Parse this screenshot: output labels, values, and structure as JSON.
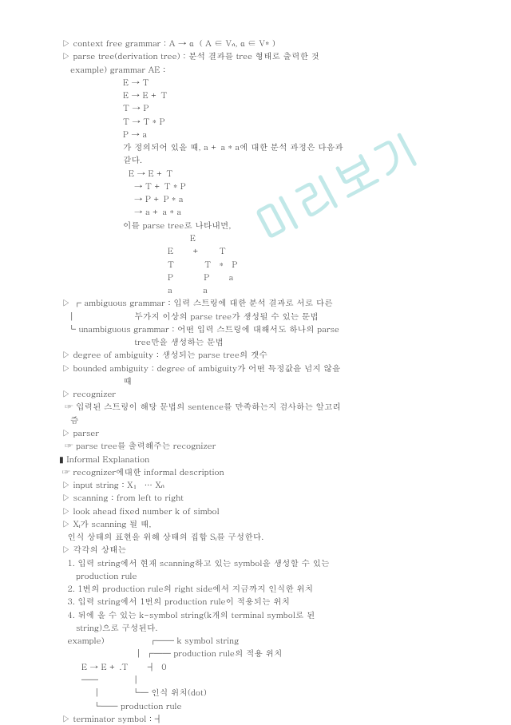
{
  "watermark": "미리보기",
  "lines": [
    " ▷ context free grammar : A → α  ( A ∈ Vₙ, α ∈ V* )",
    " ▷ parse tree(derivation tree) : 분석 결과를 tree 형태로 출력한 것",
    "example) grammar AE :",
    "E → T",
    "E → E + T",
    "T → P",
    "T → T * P",
    "P → a",
    "가 정의되어 있을 때, a + a * a에 대한 분석 과정은 다음과",
    "같다.",
    "  E → E + T",
    "    → T + T * P",
    "    → P + P * a",
    "    → a + a * a",
    "이를 parse tree로 나타내면,",
    "                        E",
    "                E       +       T",
    "                T           T   *   P",
    "                P           P       a",
    "                a           a",
    " ▷ ┌ ambiguous grammar : 입력 스트링에 대한 분석 결과로 서로 다른",
    "   │                     두가지 이상의 parse tree가 생성될 수 있는 문법",
    "   └ unambiguous grammar : 어떤 입력 스트링에 대해서도 하나의 parse",
    "                           tree만을 생성하는 문법",
    " ▷ degree of ambiguity : 생성되는 parse tree의 갯수",
    " ▷ bounded ambiguity : degree of ambiguity가 어떤 특정값을 넘지 않을",
    "                       때",
    " ▷ recognizer",
    "  ☞ 입력된 스트링이 해당 문법의 sentence를 만족하는지 검사하는 알고리",
    "    즘",
    " ▷ parser",
    "  ☞ parse tree를 출력해주는 recognizer",
    "▮ Informal Explanation",
    " ☞ recognizer에대한 informal description",
    " ▷ input string : X₁ … Xₙ",
    " ▷ scanning : from left to right",
    " ▷ look ahead fixed number k of simbol",
    " ▷ Xᵢ가 scanning 될 때,",
    "   인식 상태의 표현을 위해 상태의 집합 Sᵢ를 구성한다.",
    " ▷ 각각의 상태는",
    "   1. 입력 string에서 현재 scanning하고 있는 symbol을 생성할 수 있는",
    "      production rule",
    "   2. 1번의 production rule의 right side에서 지금까지 인식한 위치",
    "   3. 입력 string에서 1번의 production rule이 적용되는 위치",
    "   4. 뒤에 올 수 있는 k-symbol string(k개의 terminal symbol로 된",
    "      string)으로 구성된다.",
    "   example)                ┌── k symbol string",
    "                           │ ┌── production rule의 적용 위치",
    "        E → E + .T       ┤  0",
    "        ──            │",
    "            │           └─ 인식 위치(dot)",
    "            └── production rule",
    " ▷ terminator symbol : ┤",
    "",
    "",
    ""
  ]
}
